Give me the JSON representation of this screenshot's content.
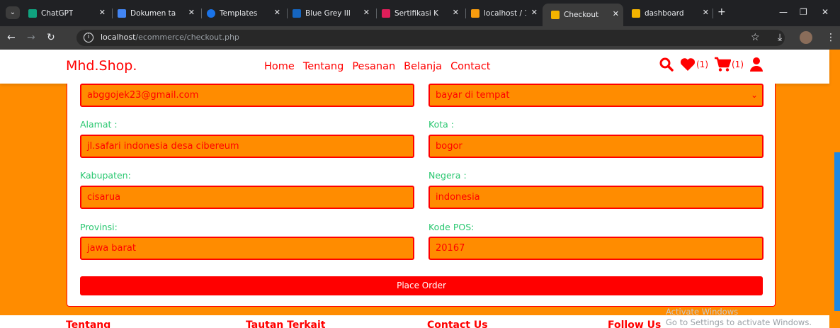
{
  "browser": {
    "tabs": [
      {
        "title": "ChatGPT",
        "favicon": "chatgpt-icon",
        "favcolor": "#10a37f"
      },
      {
        "title": "Dokumen ta",
        "favicon": "docs-icon",
        "favcolor": "#4285f4"
      },
      {
        "title": "Templates",
        "favicon": "templates-icon",
        "favcolor": "#1a73e8"
      },
      {
        "title": "Blue Grey Ill",
        "favicon": "video-icon",
        "favcolor": "#1565c0"
      },
      {
        "title": "Sertifikasi K",
        "favicon": "slack-icon",
        "favcolor": "#e01e5a"
      },
      {
        "title": "localhost / 1",
        "favicon": "phpmyadmin-icon",
        "favcolor": "#f89c0e"
      },
      {
        "title": "Checkout",
        "favicon": "page-icon",
        "favcolor": "#f4b400",
        "active": true
      },
      {
        "title": "dashboard",
        "favicon": "page-icon",
        "favcolor": "#f4b400"
      }
    ],
    "url_host": "localhost",
    "url_path": "/ecommerce/checkout.php"
  },
  "site": {
    "logo": "Mhd.Shop.",
    "nav": [
      "Home",
      "Tentang",
      "Pesanan",
      "Belanja",
      "Contact"
    ],
    "wishlist_count": "(1)",
    "cart_count": "(1)"
  },
  "form": {
    "email_value": "abggojek23@gmail.com",
    "payment_value": "bayar di tempat",
    "alamat_label": "Alamat :",
    "alamat_value": "jl.safari indonesia desa cibereum",
    "kota_label": "Kota :",
    "kota_value": "bogor",
    "kabupaten_label": "Kabupaten:",
    "kabupaten_value": "cisarua",
    "negera_label": "Negera :",
    "negera_value": "indonesia",
    "provinsi_label": "Provinsi:",
    "provinsi_value": "jawa barat",
    "kodepos_label": "Kode POS:",
    "kodepos_value": "20167",
    "place_order": "Place Order"
  },
  "footer": {
    "col1": "Tentang",
    "col2": "Tautan Terkait",
    "col3": "Contact Us",
    "col4": "Follow Us"
  },
  "os_watermark": {
    "line1": "Activate Windows",
    "line2": "Go to Settings to activate Windows."
  },
  "colors": {
    "accent": "#ff0000",
    "background": "#ff8c00",
    "label": "#28c76f"
  }
}
